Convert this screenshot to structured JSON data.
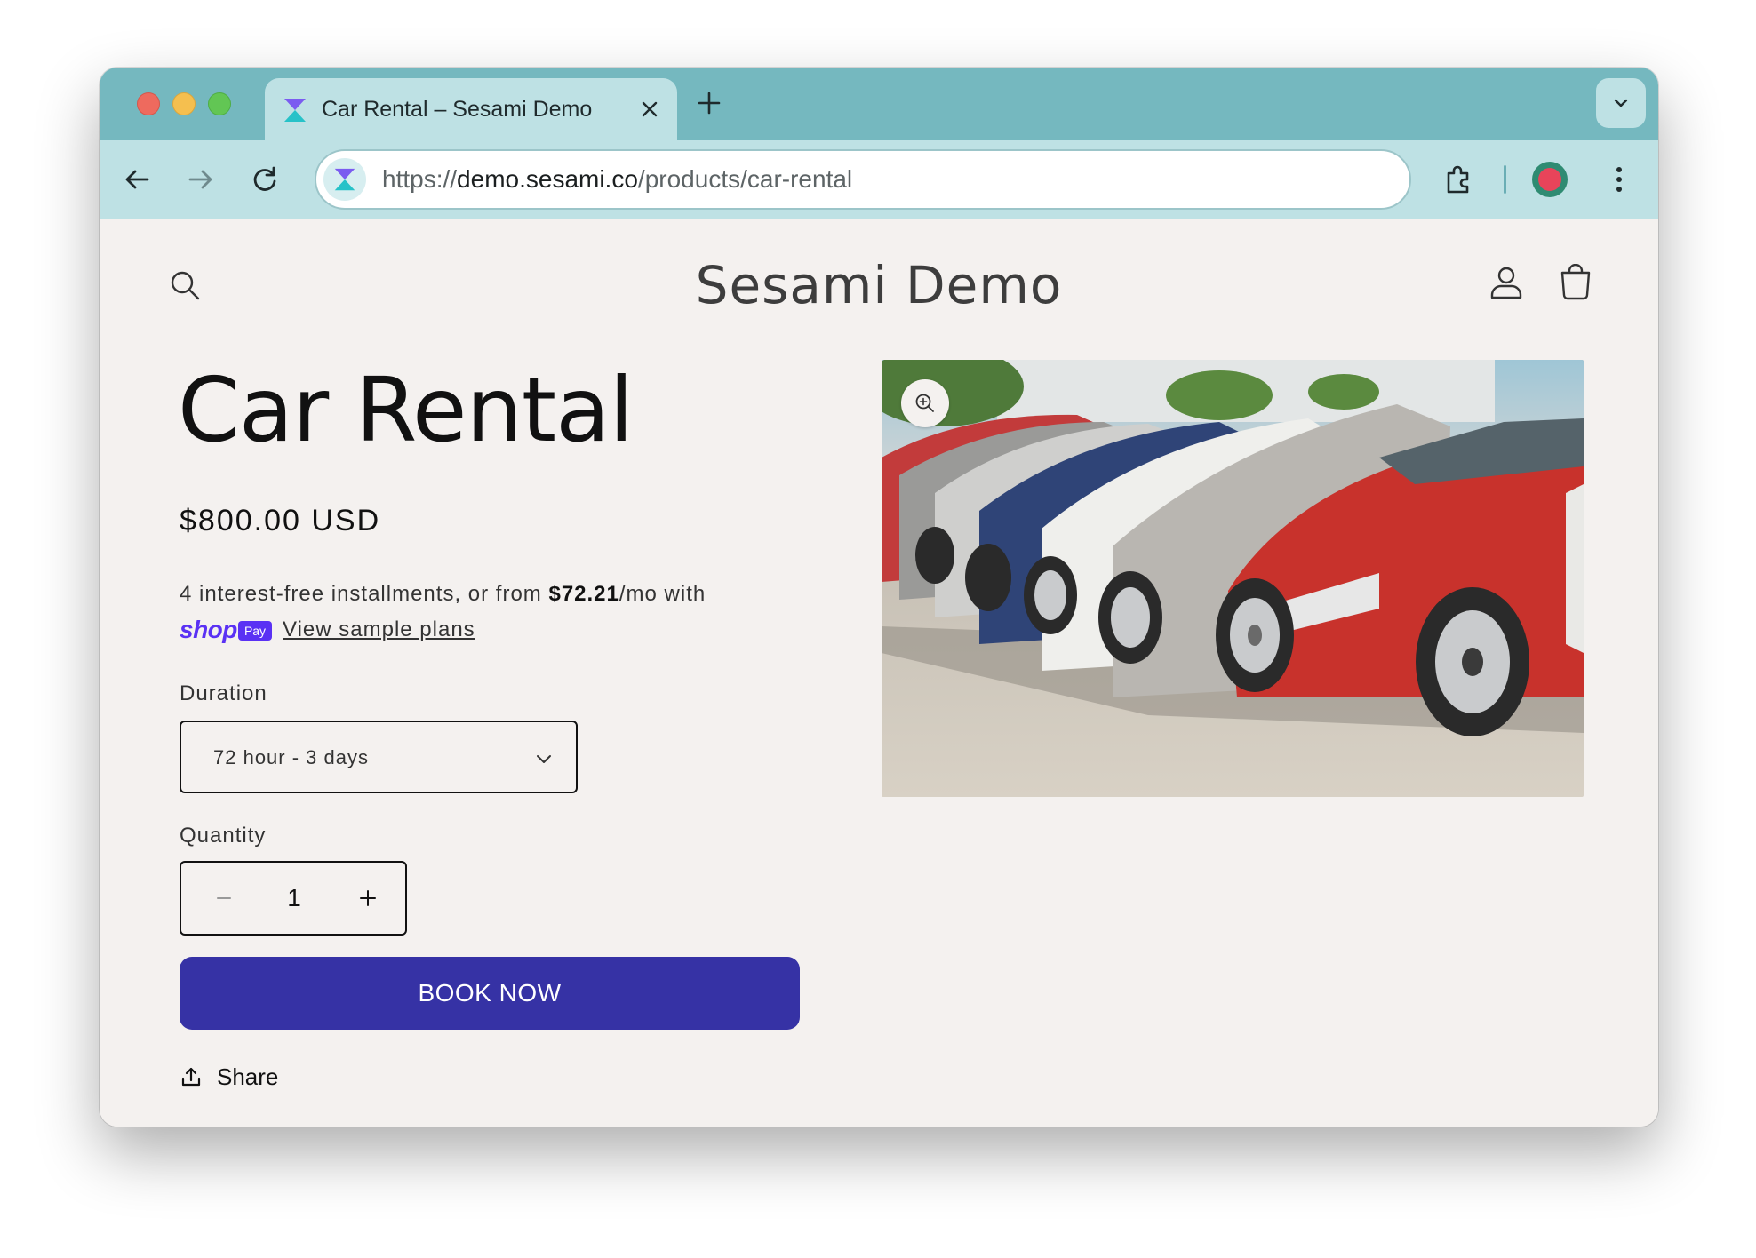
{
  "browser": {
    "tab_title": "Car Rental – Sesami Demo",
    "url_scheme": "https://",
    "url_host": "demo.sesami.co",
    "url_path": "/products/car-rental"
  },
  "header": {
    "site_title": "Sesami Demo"
  },
  "product": {
    "title": "Car Rental",
    "price": "$800.00 USD",
    "installments_prefix": "4 interest-free installments, or from ",
    "installments_amount": "$72.21",
    "installments_suffix": "/mo with",
    "shop_pay_word": "shop",
    "shop_pay_badge": "Pay",
    "sample_plans_link": "View sample plans",
    "duration_label": "Duration",
    "duration_value": "72 hour - 3 days",
    "quantity_label": "Quantity",
    "quantity_value": "1",
    "book_button": "BOOK NOW",
    "share_label": "Share"
  },
  "colors": {
    "tabstrip": "#75b8bf",
    "toolbar": "#bee1e4",
    "page_bg": "#f4f1ef",
    "book_button": "#3632a5",
    "shop_pay": "#5a31f4"
  },
  "icons": {
    "search": "search-icon",
    "account": "account-icon",
    "cart": "cart-icon",
    "zoom": "zoom-in-icon",
    "share": "share-icon",
    "back": "back-arrow-icon",
    "forward": "forward-arrow-icon",
    "reload": "reload-icon",
    "extensions": "puzzle-icon",
    "menu": "kebab-menu-icon"
  }
}
